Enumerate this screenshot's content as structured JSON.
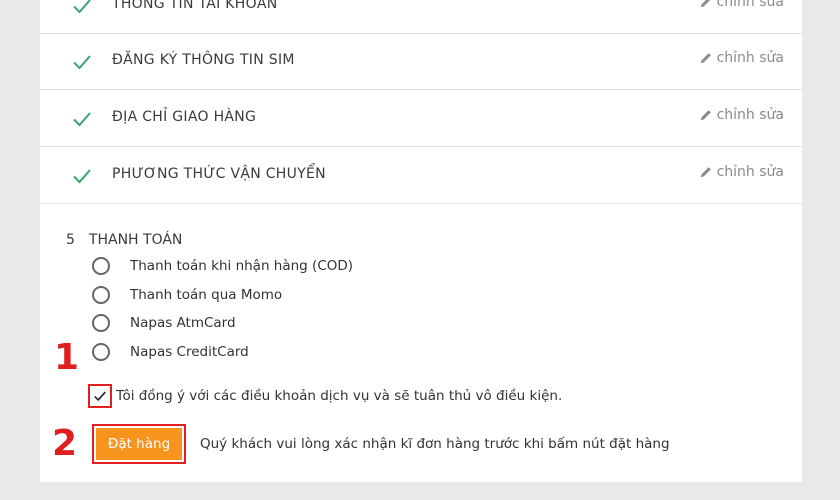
{
  "steps": [
    {
      "title": "THÔNG TIN TÀI KHOẢN",
      "edit_label": "chỉnh sửa"
    },
    {
      "title": "ĐĂNG KÝ THÔNG TIN SIM",
      "edit_label": "chỉnh sửa"
    },
    {
      "title": "ĐỊA CHỈ GIAO HÀNG",
      "edit_label": "chỉnh sửa"
    },
    {
      "title": "PHƯƠNG THỨC VẬN CHUYỂN",
      "edit_label": "chỉnh sửa"
    }
  ],
  "payment": {
    "number": "5",
    "title": "THANH TOÁN",
    "options": [
      "Thanh toán khi nhận hàng (COD)",
      "Thanh toán qua Momo",
      "Napas AtmCard",
      "Napas CreditCard"
    ]
  },
  "agreement": {
    "checked": true,
    "text": "Tôi đồng ý với các điều khoản dịch vụ và sẽ tuân thủ vô điều kiện."
  },
  "order": {
    "button_label": "Đặt hàng",
    "note": "Quý khách vui lòng xác nhận kĩ đơn hàng trước khi bấm nút đặt hàng"
  },
  "annotations": [
    "1",
    "2"
  ],
  "colors": {
    "check_green": "#3aa56b",
    "order_orange": "#f7941d",
    "annotation_red": "#e02020"
  }
}
